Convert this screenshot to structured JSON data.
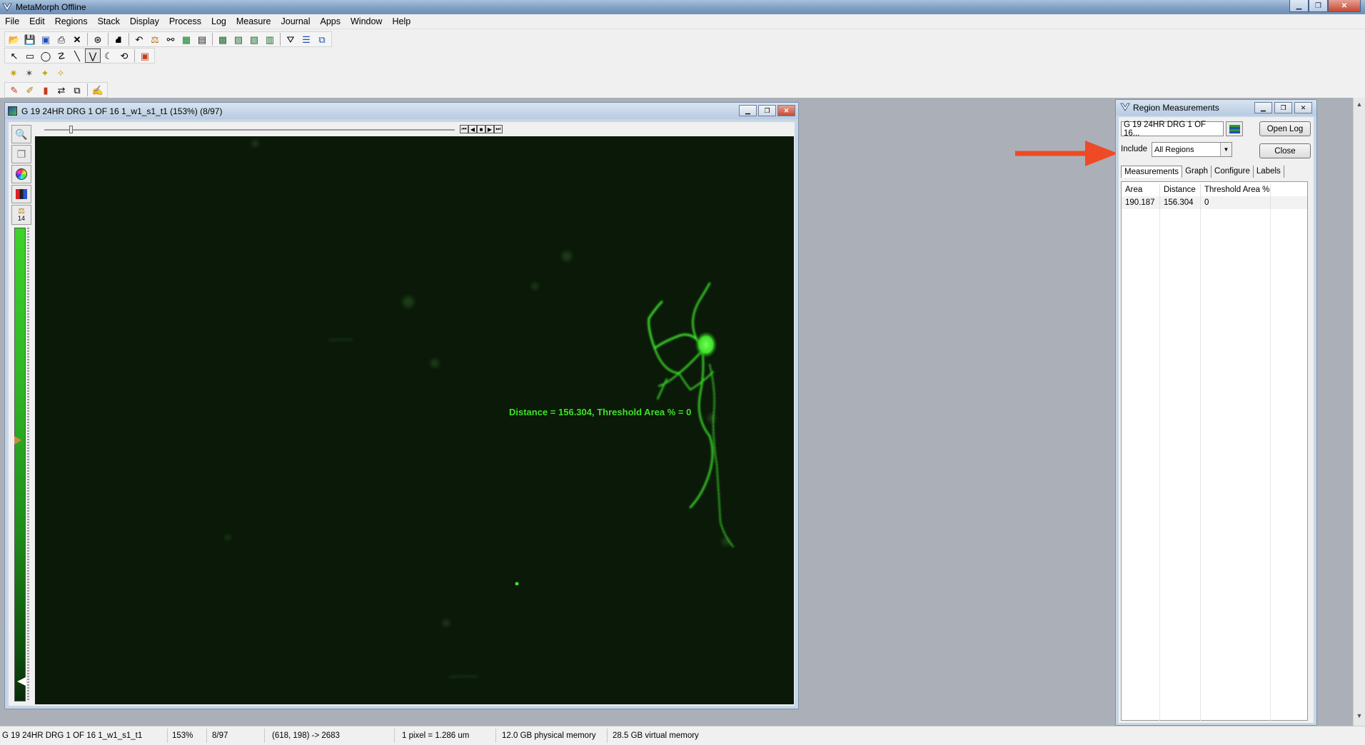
{
  "app": {
    "title": "MetaMorph Offline",
    "controls": [
      "minimize",
      "restore",
      "close"
    ]
  },
  "menu": [
    "File",
    "Edit",
    "Regions",
    "Stack",
    "Display",
    "Process",
    "Log",
    "Measure",
    "Journal",
    "Apps",
    "Window",
    "Help"
  ],
  "toolbar_icons": {
    "row1": [
      "open-folder-icon",
      "save-icon",
      "save-as-icon",
      "print-icon",
      "close-x-icon",
      "target-icon",
      "acquire-icon",
      "undo-icon",
      "scale-icon",
      "binoculars-icon",
      "filter-icon",
      "stack-icon",
      "camera-icon",
      "zoom-tool-icon",
      "settings-icon",
      "journal-icon",
      "log-icon",
      "tile-icon"
    ],
    "row2": [
      "arrow-tool-icon",
      "rectangle-tool-icon",
      "ellipse-tool-icon",
      "freehand-tool-icon",
      "line-tool-icon",
      "polyline-tool-icon",
      "arc-tool-icon",
      "spiral-tool-icon",
      "region-colors-icon"
    ],
    "row3": [
      "auto-region-icon",
      "trace-icon",
      "magic-wand-icon",
      "pin-region-icon"
    ],
    "row4": [
      "pencil-icon",
      "pencil-alt-icon",
      "eraser-icon",
      "transfer-regions-icon",
      "copy-regions-icon",
      "annotate-icon"
    ]
  },
  "image_window": {
    "title": "G 19 24HR DRG 1 OF 16 1_w1_s1_t1 (153%) (8/97)",
    "side_tools": [
      "zoom-icon",
      "copy-icon",
      "color-wheel-icon",
      "lut-icon",
      "scale-balance-icon"
    ],
    "scale_value": "14",
    "overlay_text": "Distance = 156.304, Threshold Area % = 0"
  },
  "region_measurements": {
    "title": "Region Measurements",
    "image_select": "G 19 24HR DRG 1 OF 16...",
    "open_log_button": "Open Log",
    "close_button": "Close",
    "include_label": "Include",
    "include_value": "All Regions",
    "tabs": [
      "Measurements",
      "Graph",
      "Configure",
      "Labels"
    ],
    "selected_tab": "Measurements",
    "columns": [
      "Area",
      "Distance",
      "Threshold Area %"
    ],
    "rows": [
      [
        "190.187",
        "156.304",
        "0"
      ]
    ]
  },
  "statusbar": {
    "image_name": "G 19 24HR DRG 1 OF 16 1_w1_s1_t1",
    "zoom": "153%",
    "plane": "8/97",
    "cursor": "(618, 198) -> 2683",
    "calibration": "1 pixel = 1.286 um",
    "physical_memory": "12.0 GB physical memory",
    "virtual_memory": "28.5 GB virtual memory"
  },
  "colors": {
    "fluorescence": "#3ee12a",
    "annotation_arrow": "#ee4a26",
    "canvas_bg": "#0a1908"
  }
}
